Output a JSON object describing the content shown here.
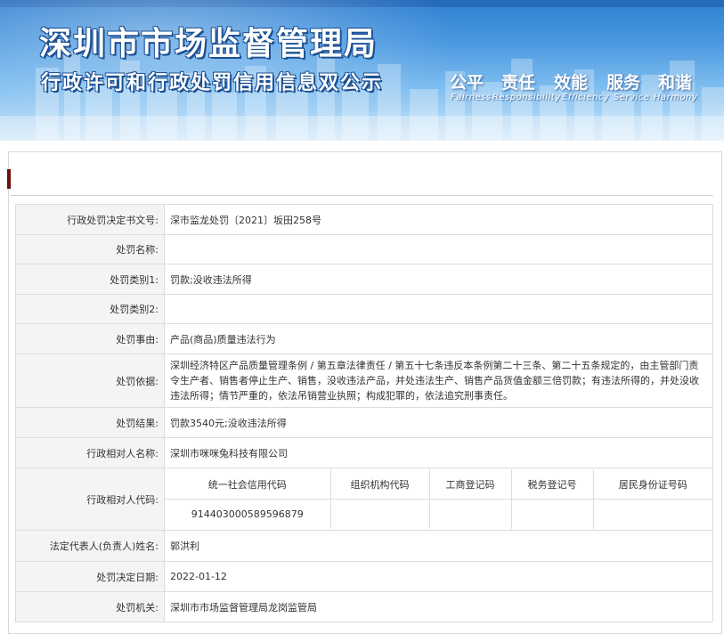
{
  "header": {
    "title": "深圳市市场监督管理局",
    "subtitle": "行政许可和行政处罚信用信息双公示",
    "motto": [
      "公平",
      "责任",
      "效能",
      "服务",
      "和谐"
    ],
    "motto_en": [
      "Fairness",
      "Responsibility",
      "Efficiency",
      "Service",
      "Harmony"
    ]
  },
  "colors": {
    "accent": "#6b0f0f",
    "banner_top": "#2f7fd0",
    "banner_bottom": "#cfe6f8",
    "label_bg": "#f4f4f4",
    "border": "#dcdcdc"
  },
  "record": {
    "rows": [
      {
        "label": "行政处罚决定书文号:",
        "value": "深市监龙处罚〔2021〕坂田258号"
      },
      {
        "label": "处罚名称:",
        "value": ""
      },
      {
        "label": "处罚类别1:",
        "value": "罚款;没收违法所得"
      },
      {
        "label": "处罚类别2:",
        "value": ""
      },
      {
        "label": "处罚事由:",
        "value": "产品(商品)质量违法行为"
      },
      {
        "label": "处罚依据:",
        "value": "深圳经济特区产品质量管理条例 / 第五章法律责任 / 第五十七条违反本条例第二十三条、第二十五条规定的，由主管部门责令生产者、销售者停止生产、销售，没收违法产品，并处违法生产、销售产品货值金额三倍罚款；有违法所得的，并处没收违法所得；情节严重的，依法吊销营业执照；构成犯罪的，依法追究刑事责任。"
      },
      {
        "label": "处罚结果:",
        "value": "罚款3540元;没收违法所得"
      },
      {
        "label": "行政相对人名称:",
        "value": "深圳市咪咪兔科技有限公司"
      }
    ],
    "code_row": {
      "label": "行政相对人代码:",
      "headers": [
        "统一社会信用代码",
        "组织机构代码",
        "工商登记码",
        "税务登记号",
        "居民身份证号码"
      ],
      "values": [
        "91440300058959687​9",
        "",
        "",
        "",
        ""
      ]
    },
    "rows_after": [
      {
        "label": "法定代表人(负责人)姓名:",
        "value": "郭洪利"
      },
      {
        "label": "处罚决定日期:",
        "value": "2022-01-12"
      },
      {
        "label": "处罚机关:",
        "value": "深圳市市场监督管理局龙岗监管局"
      }
    ]
  }
}
